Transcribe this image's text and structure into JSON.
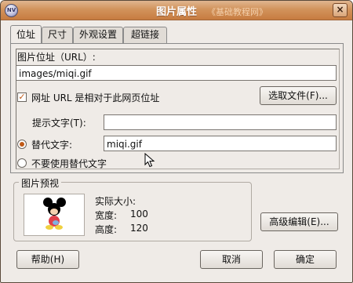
{
  "window": {
    "title": "图片属性",
    "icon": "app-icon",
    "icon_text": "NV",
    "watermark": "《基础教程网》",
    "close_glyph": "×"
  },
  "tabs": [
    {
      "label": "位址",
      "active": true
    },
    {
      "label": "尺寸",
      "active": false
    },
    {
      "label": "外观设置",
      "active": false
    },
    {
      "label": "超链接",
      "active": false
    }
  ],
  "location": {
    "url_label": "图片位址（URL）:",
    "url_value": "images/miqi.gif",
    "relative_checked": true,
    "relative_label": "网址 URL 是相对于此网页位址",
    "choose_file_button": "选取文件(F)...",
    "tooltip_label": "提示文字(T):",
    "tooltip_value": "",
    "alt_label": "替代文字:",
    "alt_value": "miqi.gif",
    "alt_selected": true,
    "no_alt_label": "不要使用替代文字",
    "no_alt_selected": false
  },
  "preview": {
    "group_title": "图片预视",
    "actual_size_label": "实际大小:",
    "width_label": "宽度:",
    "width_value": "100",
    "height_label": "高度:",
    "height_value": "120"
  },
  "buttons": {
    "advanced_edit": "高级编辑(E)...",
    "help": "帮助(H)",
    "cancel": "取消",
    "ok": "确定"
  },
  "colors": {
    "titlebar": "#d2935c",
    "accent": "#c05a18",
    "background": "#efebe7"
  }
}
